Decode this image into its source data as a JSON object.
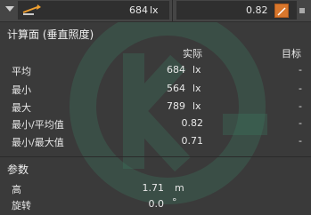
{
  "top": {
    "illuminance_value": "684",
    "illuminance_unit": "lx",
    "ratio_value": "0.82"
  },
  "section1": {
    "title": "计算面 (垂直照度)",
    "col_actual": "实际",
    "col_target": "目标",
    "rows": [
      {
        "label": "平均",
        "value": "684",
        "unit": "lx",
        "target": "-"
      },
      {
        "label": "最小",
        "value": "564",
        "unit": "lx",
        "target": "-"
      },
      {
        "label": "最大",
        "value": "789",
        "unit": "lx",
        "target": "-"
      },
      {
        "label": "最小/平均值",
        "value": "0.82",
        "unit": "",
        "target": "-"
      },
      {
        "label": "最小/最大值",
        "value": "0.71",
        "unit": "",
        "target": "-"
      }
    ]
  },
  "section2": {
    "title": "参数",
    "rows": [
      {
        "label": "高",
        "value": "1.71",
        "unit": "m"
      },
      {
        "label": "旋转",
        "value": "0.0",
        "unit": "°"
      }
    ]
  }
}
